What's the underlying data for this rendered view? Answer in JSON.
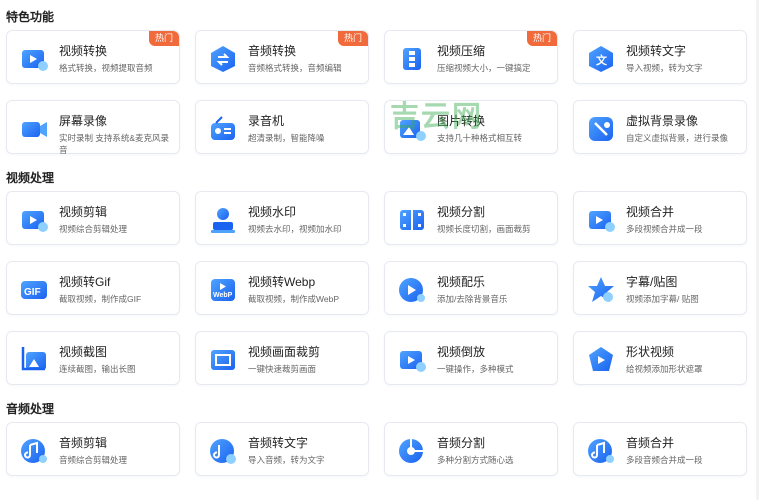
{
  "sections": [
    {
      "title": "特色功能"
    },
    {
      "title": "视频处理"
    },
    {
      "title": "音频处理"
    }
  ],
  "hot_label": "热门",
  "watermark": "吉云网",
  "cards": [
    {
      "title": "视频转换",
      "desc": "格式转换，视频提取音频",
      "icon": "video-convert-icon",
      "hot": true
    },
    {
      "title": "音频转换",
      "desc": "音频格式转换，音频编辑",
      "icon": "audio-convert-icon",
      "hot": true
    },
    {
      "title": "视频压缩",
      "desc": "压缩视频大小，一键搞定",
      "icon": "video-compress-icon",
      "hot": true
    },
    {
      "title": "视频转文字",
      "desc": "导入视频，转为文字",
      "icon": "video-to-text-icon",
      "hot": false
    },
    {
      "title": "屏幕录像",
      "desc": "实时录制 支持系统&麦克风录音",
      "icon": "screen-record-icon",
      "hot": false
    },
    {
      "title": "录音机",
      "desc": "超清录制，智能降噪",
      "icon": "recorder-icon",
      "hot": false
    },
    {
      "title": "图片转换",
      "desc": "支持几十种格式相互转",
      "icon": "image-convert-icon",
      "hot": false
    },
    {
      "title": "虚拟背景录像",
      "desc": "自定义虚拟背景，进行录像",
      "icon": "virtual-bg-icon",
      "hot": false
    },
    {
      "title": "视频剪辑",
      "desc": "视频综合剪辑处理",
      "icon": "video-edit-icon",
      "hot": false
    },
    {
      "title": "视频水印",
      "desc": "视频去水印，视频加水印",
      "icon": "video-watermark-icon",
      "hot": false
    },
    {
      "title": "视频分割",
      "desc": "视频长度切割，画面裁剪",
      "icon": "video-split-icon",
      "hot": false
    },
    {
      "title": "视频合并",
      "desc": "多段视频合并成一段",
      "icon": "video-merge-icon",
      "hot": false
    },
    {
      "title": "视频转Gif",
      "desc": "截取视频，制作成GIF",
      "icon": "gif-icon",
      "hot": false
    },
    {
      "title": "视频转Webp",
      "desc": "截取视频，制作成WebP",
      "icon": "webp-icon",
      "hot": false
    },
    {
      "title": "视频配乐",
      "desc": "添加/去除背景音乐",
      "icon": "video-music-icon",
      "hot": false
    },
    {
      "title": "字幕/贴图",
      "desc": "视频添加字幕/ 贴图",
      "icon": "subtitle-sticker-icon",
      "hot": false
    },
    {
      "title": "视频截图",
      "desc": "连续截图，输出长图",
      "icon": "video-screenshot-icon",
      "hot": false
    },
    {
      "title": "视频画面裁剪",
      "desc": "一键快速裁剪画面",
      "icon": "video-crop-icon",
      "hot": false
    },
    {
      "title": "视频倒放",
      "desc": "一键操作，多种模式",
      "icon": "video-reverse-icon",
      "hot": false
    },
    {
      "title": "形状视频",
      "desc": "给视频添加形状遮罩",
      "icon": "shape-video-icon",
      "hot": false
    },
    {
      "title": "音频剪辑",
      "desc": "音频综合剪辑处理",
      "icon": "audio-edit-icon",
      "hot": false
    },
    {
      "title": "音频转文字",
      "desc": "导入音频，转为文字",
      "icon": "audio-to-text-icon",
      "hot": false
    },
    {
      "title": "音频分割",
      "desc": "多种分割方式随心选",
      "icon": "audio-split-icon",
      "hot": false
    },
    {
      "title": "音频合并",
      "desc": "多段音频合并成一段",
      "icon": "audio-merge-icon",
      "hot": false
    }
  ]
}
